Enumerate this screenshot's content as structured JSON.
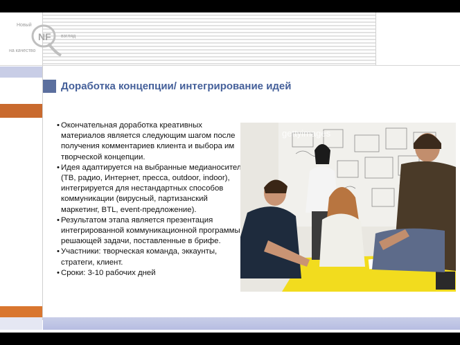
{
  "logo": {
    "text_new": "Новый",
    "text_look": "взгляд",
    "text_quality": "на качество",
    "letters": "NF"
  },
  "slide": {
    "title": "Доработка концепции/ интегрирование идей",
    "bullets": [
      "Окончательная доработка креативных материалов является следующим шагом после получения комментариев клиента и выбора им творческой концепции.",
      "Идея адаптируется на выбранные медианосители (ТВ, радио, Интернет, пресса, outdoor, indoor), интегрируется для нестандартных способов коммуникации (вирусный, партизанский  маркетинг, BTL, event-предложение).",
      "Результатом этапа является презентация интегрированной коммуникационной программы, решающей задачи, поставленные в брифе.",
      "Участники: творческая команда, эккаунты, стратеги, клиент.",
      "Сроки: 3-10 рабочих дней"
    ]
  },
  "photo": {
    "watermark": "gettyimages"
  },
  "colors": {
    "title": "#45609a",
    "accent_orange": "#c96a2e",
    "band": "#c9cee8",
    "table_yellow": "#f2dc1e"
  }
}
